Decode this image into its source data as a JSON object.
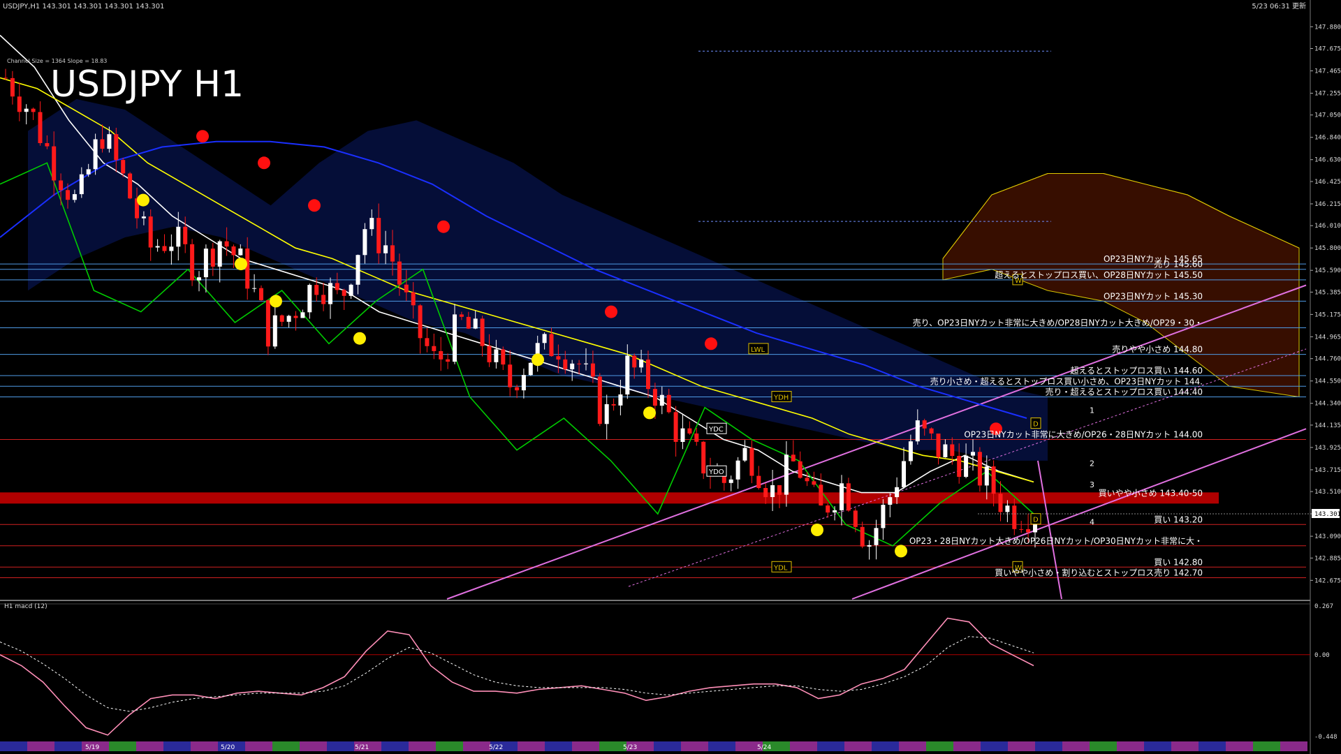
{
  "header": {
    "info": "USDJPY,H1  143.301 143.301 143.301 143.301",
    "updated": "5/23 06:31 更新",
    "channel": "Channel Size = 1364 Slope = 18.83"
  },
  "watermark": "USDJPY H1",
  "chart_data": [
    {
      "type": "candlestick",
      "title": "USDJPY H1",
      "ylim": [
        142.5,
        148.0
      ],
      "last_price": "143.301",
      "price_ticks": [
        "147.880",
        "147.675",
        "147.465",
        "147.255",
        "147.050",
        "146.840",
        "146.630",
        "146.425",
        "146.215",
        "146.010",
        "145.800",
        "145.590",
        "145.385",
        "145.175",
        "144.965",
        "144.760",
        "144.550",
        "144.340",
        "144.135",
        "143.925",
        "143.715",
        "143.510",
        "143.301",
        "143.090",
        "142.885",
        "142.675"
      ],
      "date_labels": [
        "5/19",
        "5/20",
        "5/21",
        "5/22",
        "5/23",
        "5/24"
      ],
      "price_path": [
        147.4,
        147.1,
        146.6,
        146.2,
        146.9,
        146.4,
        145.8,
        145.9,
        145.6,
        145.9,
        145.6,
        145.0,
        145.2,
        145.5,
        145.3,
        146.0,
        145.8,
        145.1,
        144.7,
        145.1,
        144.9,
        144.5,
        144.8,
        144.9,
        144.7,
        144.2,
        144.7,
        144.5,
        144.1,
        143.8,
        143.6,
        143.9,
        143.5,
        143.8,
        143.3,
        143.6,
        143.0,
        143.5,
        144.1,
        143.9,
        143.8,
        143.6,
        143.3,
        143.301
      ],
      "series": [
        {
          "name": "",
          "color": "#ffffff",
          "values": [
            147.8,
            147.5,
            147.0,
            146.6,
            146.4,
            146.1,
            145.9,
            145.7,
            145.6,
            145.5,
            145.4,
            145.2,
            145.1,
            145.0,
            144.9,
            144.8,
            144.7,
            144.6,
            144.5,
            144.4,
            144.2,
            144.0,
            143.9,
            143.7,
            143.6,
            143.5,
            143.5,
            143.7,
            143.85,
            143.7,
            143.6
          ]
        },
        {
          "name": "",
          "color": "#ffff00",
          "values": [
            147.4,
            147.3,
            147.1,
            146.9,
            146.6,
            146.4,
            146.2,
            146.0,
            145.8,
            145.7,
            145.55,
            145.4,
            145.3,
            145.2,
            145.1,
            145.0,
            144.9,
            144.8,
            144.65,
            144.5,
            144.4,
            144.3,
            144.2,
            144.05,
            143.95,
            143.85,
            143.8,
            143.7,
            143.6
          ]
        },
        {
          "name": "",
          "color": "#1a2fff",
          "values": [
            145.9,
            146.3,
            146.6,
            146.75,
            146.8,
            146.8,
            146.75,
            146.6,
            146.4,
            146.1,
            145.85,
            145.6,
            145.4,
            145.2,
            145.0,
            144.85,
            144.7,
            144.5,
            144.35,
            144.2
          ]
        },
        {
          "name": "",
          "color": "#00cc00",
          "values": [
            146.4,
            146.6,
            145.4,
            145.2,
            145.6,
            145.1,
            145.4,
            144.9,
            145.3,
            145.6,
            144.4,
            143.9,
            144.2,
            143.8,
            143.3,
            144.3,
            144.0,
            143.8,
            143.2,
            143.0,
            143.4,
            143.7,
            143.3
          ]
        }
      ],
      "levels": [
        {
          "price": 145.65,
          "label": "OP23日NYカット 145.65",
          "color": "#4f9be6"
        },
        {
          "price": 145.6,
          "label": "売り 145.60",
          "color": "#4f9be6"
        },
        {
          "price": 145.5,
          "label": "超えるとストップロス買い、OP28日NYカット 145.50",
          "color": "#4f9be6"
        },
        {
          "price": 145.3,
          "label": "OP23日NYカット 145.30",
          "color": "#4f9be6"
        },
        {
          "price": 145.05,
          "label": "売り、OP23日NYカット非常に大きめ/OP28日NYカット大きめ/OP29・30・",
          "color": "#4f9be6"
        },
        {
          "price": 144.8,
          "label": "売りやや小さめ 144.80",
          "color": "#4f9be6"
        },
        {
          "price": 144.6,
          "label": "超えるとストップロス買い 144.60",
          "color": "#4f9be6"
        },
        {
          "price": 144.5,
          "label": "売り小さめ・超えるとストップロス買い小さめ、OP23日NYカット 144.",
          "color": "#4f9be6"
        },
        {
          "price": 144.4,
          "label": "売り・超えるとストップロス買い 144.40",
          "color": "#4f9be6"
        },
        {
          "price": 144.0,
          "label": "OP23日NYカット非常に大きめ/OP26・28日NYカット 144.00",
          "color": "#d02020"
        },
        {
          "price": 143.45,
          "label": "買いやや小さめ 143.40-50",
          "color": "#b00000",
          "band": true
        },
        {
          "price": 143.2,
          "label": "買い 143.20",
          "color": "#d02020"
        },
        {
          "price": 143.0,
          "label": "OP23・28日NYカット大きめ/OP26日NYカット/OP30日NYカット非常に大・",
          "color": "#d02020"
        },
        {
          "price": 142.8,
          "label": "買い 142.80",
          "color": "#d02020"
        },
        {
          "price": 142.7,
          "label": "買いやや小さめ・割り込むとストップロス売り 142.70",
          "color": "#d02020"
        }
      ],
      "tags": [
        "LWL",
        "YDH",
        "YDC",
        "YDO",
        "YDL",
        "W",
        "D",
        "D",
        "W"
      ],
      "projection_labels": [
        "1",
        "2",
        "3",
        "4"
      ]
    },
    {
      "type": "line",
      "title": "H1  macd (12)",
      "ylim": [
        -0.448,
        0.267
      ],
      "ticks": [
        "0.267",
        "0.00",
        "-0.448"
      ],
      "series": [
        {
          "name": "",
          "color": "#ff8fb8",
          "values": [
            0.0,
            -0.06,
            -0.15,
            -0.28,
            -0.4,
            -0.44,
            -0.33,
            -0.24,
            -0.22,
            -0.22,
            -0.24,
            -0.21,
            -0.2,
            -0.21,
            -0.22,
            -0.18,
            -0.12,
            0.02,
            0.13,
            0.11,
            -0.06,
            -0.15,
            -0.2,
            -0.2,
            -0.21,
            -0.19,
            -0.18,
            -0.17,
            -0.19,
            -0.21,
            -0.25,
            -0.23,
            -0.2,
            -0.18,
            -0.17,
            -0.16,
            -0.16,
            -0.18,
            -0.24,
            -0.22,
            -0.16,
            -0.13,
            -0.08,
            0.06,
            0.2,
            0.18,
            0.06,
            0.0,
            -0.06
          ]
        },
        {
          "name": "",
          "color": "#ffffff",
          "dashed": true,
          "values": [
            0.07,
            0.02,
            -0.05,
            -0.13,
            -0.22,
            -0.29,
            -0.31,
            -0.29,
            -0.26,
            -0.24,
            -0.23,
            -0.22,
            -0.21,
            -0.21,
            -0.21,
            -0.2,
            -0.17,
            -0.1,
            -0.02,
            0.04,
            0.01,
            -0.05,
            -0.11,
            -0.15,
            -0.17,
            -0.18,
            -0.18,
            -0.18,
            -0.18,
            -0.19,
            -0.21,
            -0.22,
            -0.21,
            -0.2,
            -0.19,
            -0.18,
            -0.17,
            -0.17,
            -0.19,
            -0.2,
            -0.19,
            -0.16,
            -0.12,
            -0.06,
            0.04,
            0.1,
            0.09,
            0.05,
            0.01
          ]
        }
      ]
    }
  ]
}
